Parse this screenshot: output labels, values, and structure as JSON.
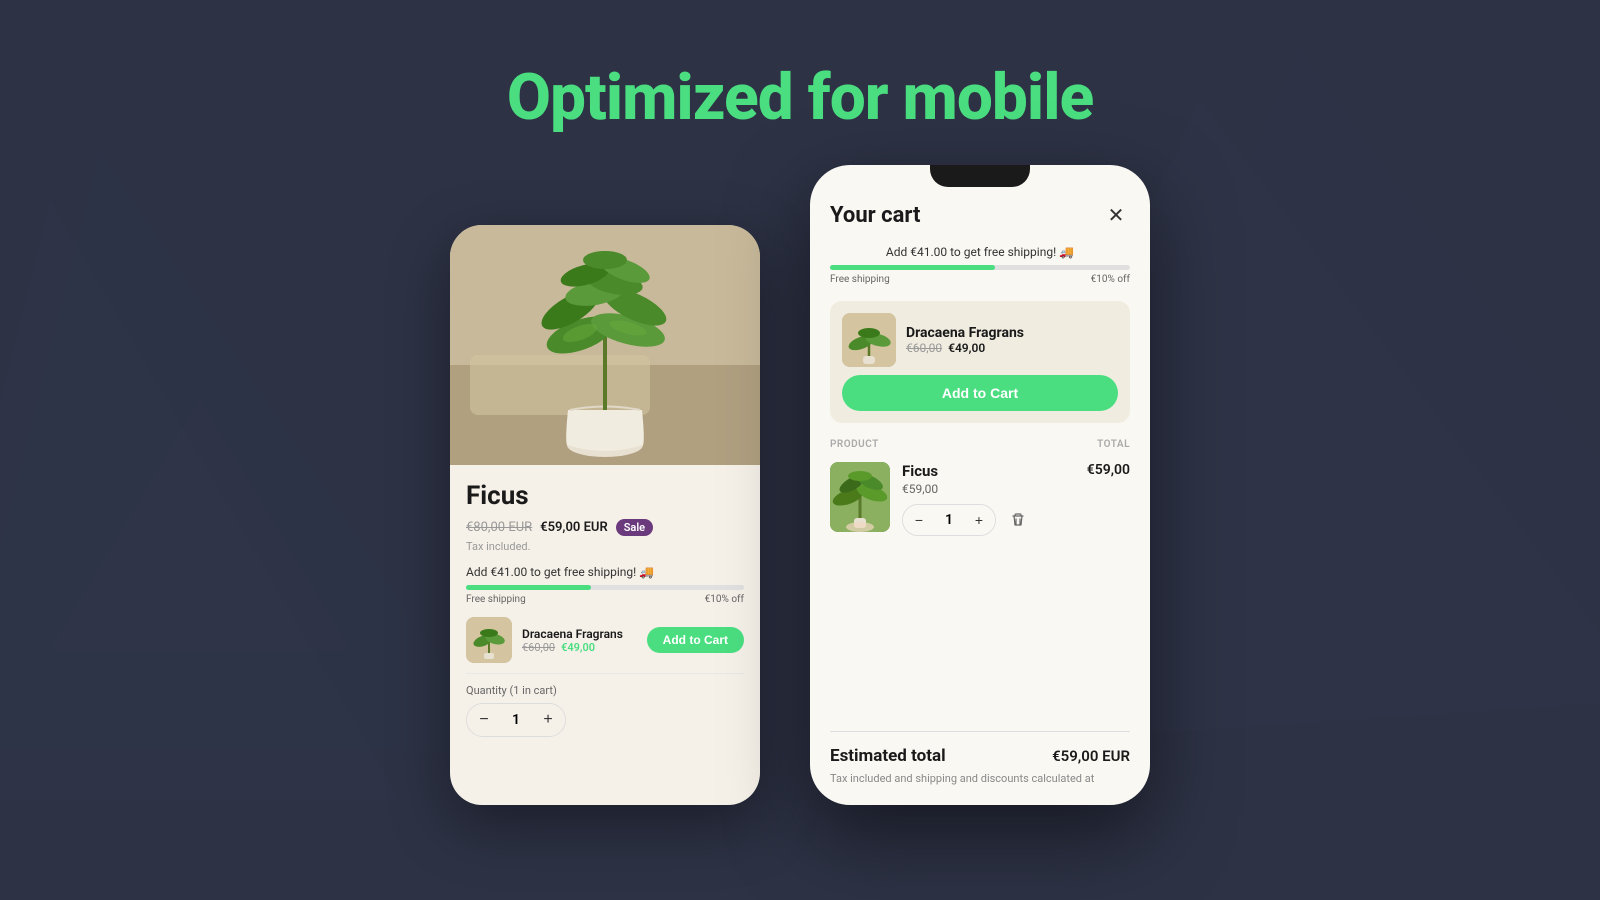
{
  "page": {
    "title": "Optimized for mobile",
    "background_color": "#2d3245"
  },
  "phone_left": {
    "product": {
      "name": "Ficus",
      "original_price": "€80,00 EUR",
      "sale_price": "€59,00 EUR",
      "sale_badge": "Sale",
      "tax_note": "Tax included.",
      "shipping_promo": "Add €41.00 to get free shipping! 🚚",
      "progress_label_left": "Free shipping",
      "progress_label_right": "€10% off",
      "progress_percent": 45
    },
    "upsell": {
      "name": "Dracaena Fragrans",
      "original_price": "€60,00",
      "sale_price": "€49,00",
      "add_to_cart_label": "Add to Cart"
    },
    "quantity": {
      "label": "Quantity (1 in cart)",
      "value": 1
    }
  },
  "phone_right": {
    "cart": {
      "title": "Your cart",
      "shipping_promo": "Add €41.00 to get free shipping! 🚚",
      "progress_label_left": "Free shipping",
      "progress_label_right": "€10% off",
      "progress_percent": 55
    },
    "upsell": {
      "name": "Dracaena Fragrans",
      "original_price": "€60,00",
      "sale_price": "€49,00",
      "add_to_cart_label": "Add to Cart"
    },
    "table": {
      "col_product": "PRODUCT",
      "col_total": "TOTAL"
    },
    "item": {
      "name": "Ficus",
      "price": "€59,00",
      "total": "€59,00",
      "quantity": 1
    },
    "footer": {
      "estimated_total_label": "Estimated total",
      "estimated_total_value": "€59,00 EUR",
      "tax_info": "Tax included and shipping and discounts calculated at"
    }
  },
  "icons": {
    "close": "✕",
    "minus": "−",
    "plus": "+",
    "trash": "🗑"
  }
}
